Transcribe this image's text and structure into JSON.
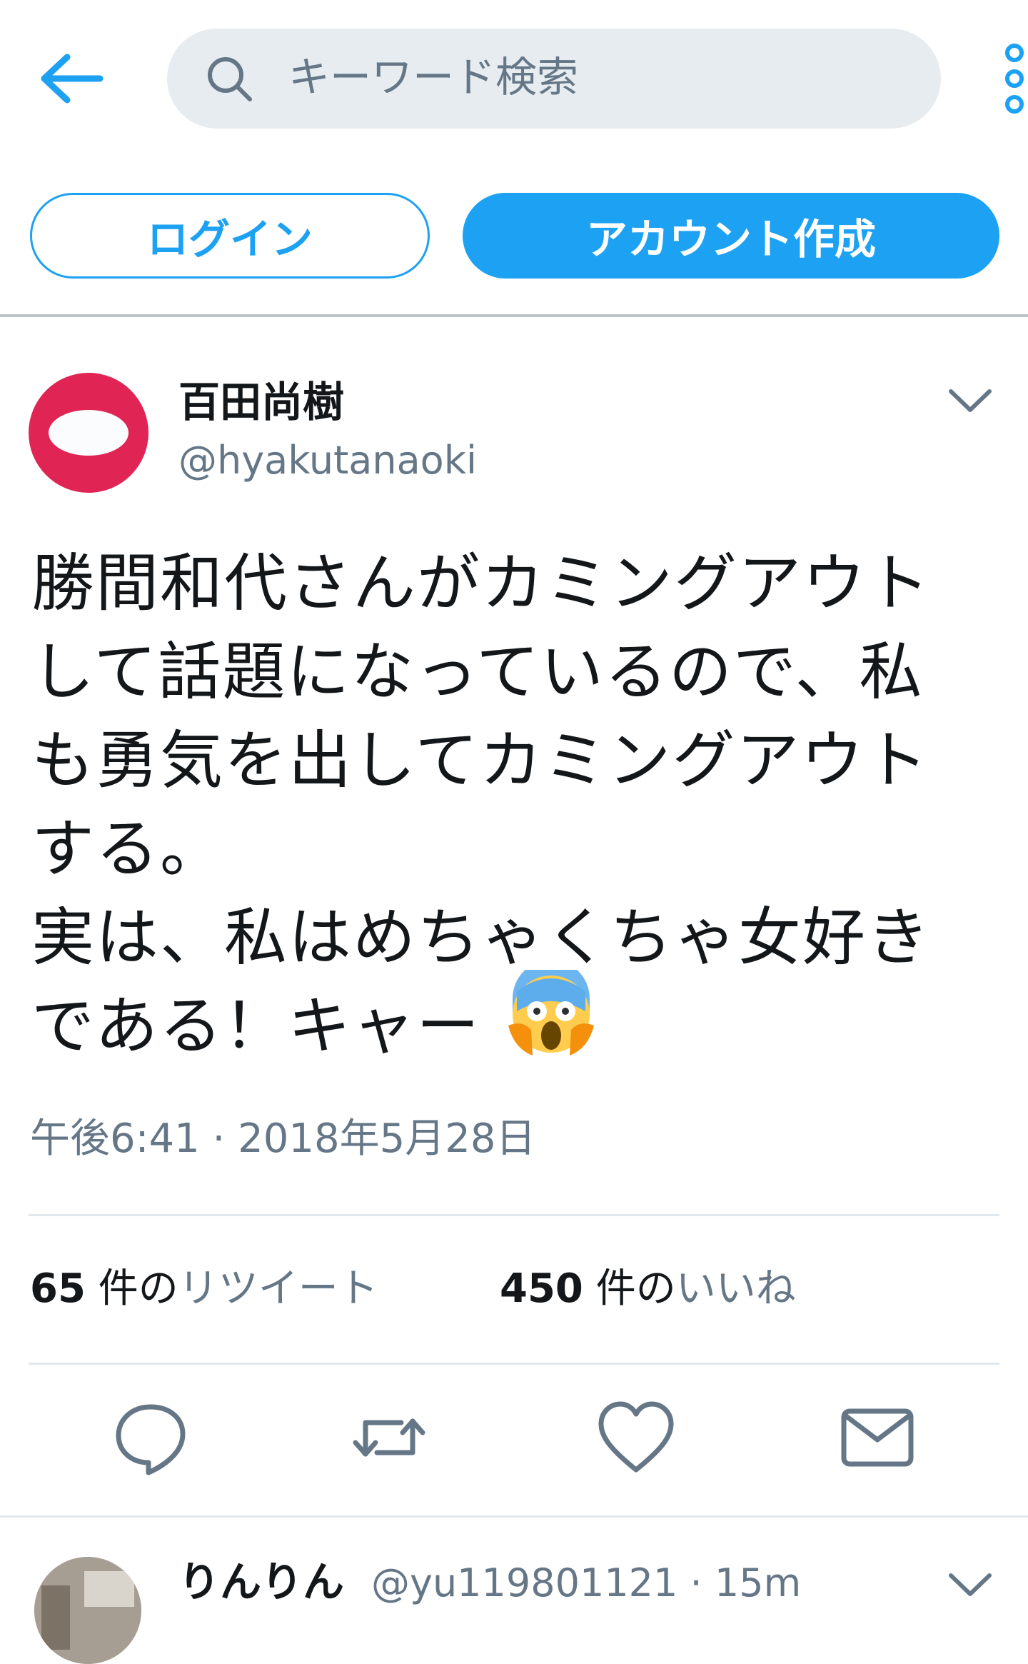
{
  "search": {
    "placeholder": "キーワード検索"
  },
  "auth": {
    "login_label": "ログイン",
    "signup_label": "アカウント作成"
  },
  "tweet": {
    "author_name": "百田尚樹",
    "author_handle": "@hyakutanaoki",
    "text": "勝間和代さんがカミングアウト\nして話題になっているので、私\nも勇気を出してカミングアウト\nする。\n実は、私はめちゃくちゃ女好き\nである！キャー",
    "emoji": "😱",
    "timestamp": "午後6:41 · 2018年5月28日",
    "retweets": {
      "count": "65",
      "unit": " 件の",
      "label": "リツイート"
    },
    "likes": {
      "count": "450",
      "unit": " 件の",
      "label": "いいね"
    }
  },
  "next_tweet": {
    "author_name": "りんりん",
    "meta": "@yu119801121 · 15m"
  },
  "icons": {
    "back": "arrow-left-icon",
    "search": "search-icon",
    "more": "vertical-dots-icon",
    "caret": "chevron-down-icon",
    "reply": "reply-icon",
    "retweet": "retweet-icon",
    "like": "heart-icon",
    "message": "envelope-icon"
  },
  "colors": {
    "accent": "#1da1f2",
    "avatar": "#e02454",
    "muted": "#657786"
  }
}
